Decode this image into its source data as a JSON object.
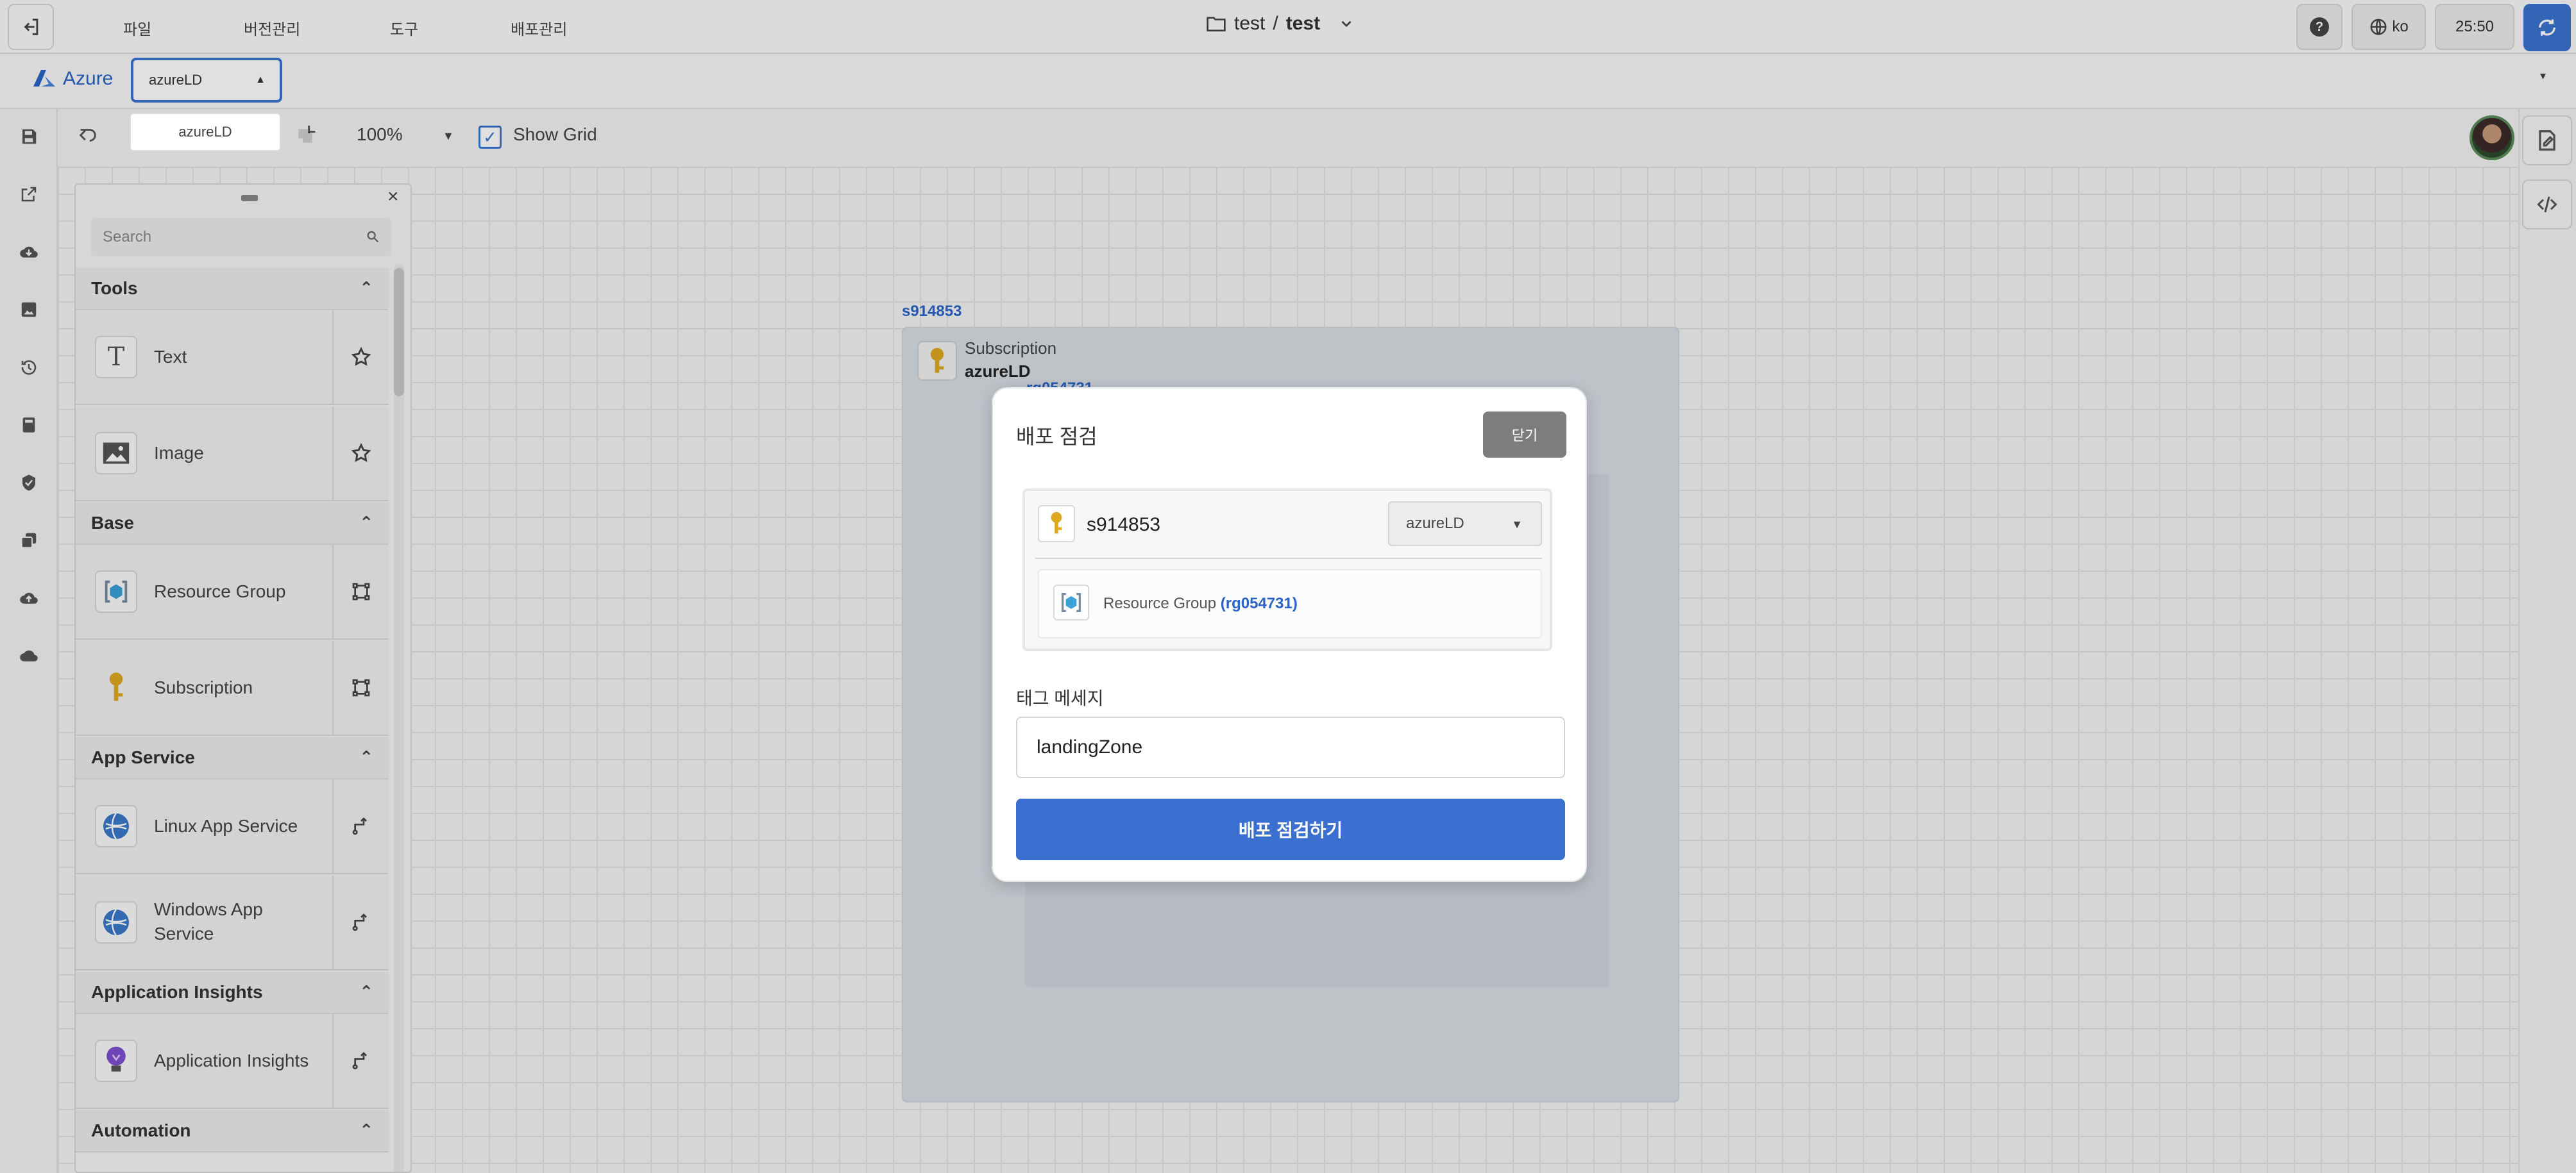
{
  "menu": {
    "items": [
      "파일",
      "버전관리",
      "도구",
      "배포관리"
    ]
  },
  "project": {
    "owner": "test",
    "separator": "/",
    "name": "test"
  },
  "topright": {
    "language": "ko",
    "timer": "25:50"
  },
  "tabs": {
    "provider_label": "Azure",
    "selected_csp": "azureLD",
    "dropdown_option": "azureLD"
  },
  "toolbar": {
    "zoom": "100%",
    "show_grid_label": "Show Grid",
    "show_grid_checked": true
  },
  "palette": {
    "search_placeholder": "Search",
    "sections": [
      {
        "title": "Tools",
        "items": [
          {
            "label": "Text",
            "icon": "text-icon",
            "action": "star-icon"
          },
          {
            "label": "Image",
            "icon": "image-icon",
            "action": "star-icon"
          }
        ]
      },
      {
        "title": "Base",
        "items": [
          {
            "label": "Resource Group",
            "icon": "resource-group-icon",
            "action": "container-icon"
          },
          {
            "label": "Subscription",
            "icon": "key-icon",
            "action": "container-icon"
          }
        ]
      },
      {
        "title": "App Service",
        "items": [
          {
            "label": "Linux App Service",
            "icon": "app-service-icon",
            "action": "connector-icon"
          },
          {
            "label": "Windows App Service",
            "icon": "app-service-icon",
            "action": "connector-icon"
          }
        ]
      },
      {
        "title": "Application Insights",
        "items": [
          {
            "label": "Application Insights",
            "icon": "lightbulb-icon",
            "action": "connector-icon"
          }
        ]
      },
      {
        "title": "Automation",
        "items": []
      }
    ]
  },
  "diagram": {
    "subscription_id": "s914853",
    "subscription_type": "Subscription",
    "subscription_name": "azureLD",
    "rg_peek": "rg054731"
  },
  "modal": {
    "title": "배포 점검",
    "close_label": "닫기",
    "subscription_id": "s914853",
    "csp_select": "azureLD",
    "rg_type": "Resource Group",
    "rg_id": "(rg054731)",
    "tag_label": "태그 메세지",
    "tag_value": "landingZone",
    "submit_label": "배포 점검하기"
  },
  "colors": {
    "primary": "#3b6fd0",
    "accent": "#2a64c9"
  }
}
